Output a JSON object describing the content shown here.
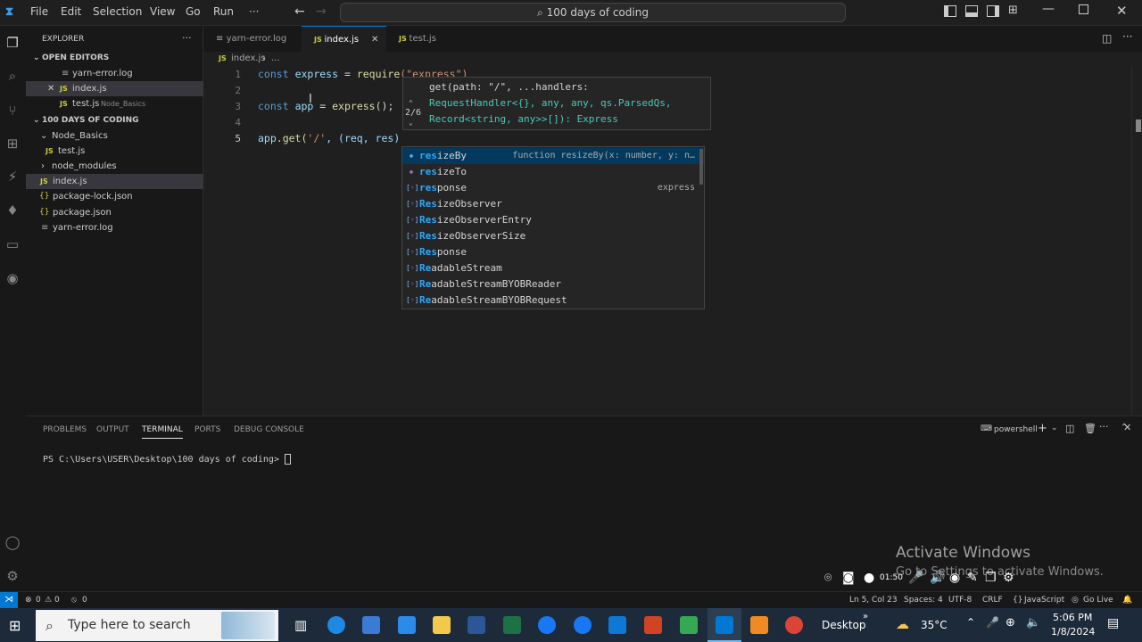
{
  "menu": {
    "file": "File",
    "edit": "Edit",
    "selection": "Selection",
    "view": "View",
    "go": "Go",
    "run": "Run",
    "more": "···"
  },
  "search": {
    "label": "100 days of coding"
  },
  "explorer": {
    "title": "EXPLORER",
    "more": "···",
    "open_editors_header": "OPEN EDITORS",
    "open_editors": [
      {
        "name": "yarn-error.log",
        "hint": ""
      },
      {
        "name": "index.js",
        "hint": ""
      },
      {
        "name": "test.js",
        "hint": "Node_Basics"
      }
    ],
    "folder_header": "100 DAYS OF CODING",
    "tree": [
      {
        "name": "Node_Basics"
      },
      {
        "name": "test.js"
      },
      {
        "name": "node_modules"
      },
      {
        "name": "index.js"
      },
      {
        "name": "package-lock.json"
      },
      {
        "name": "package.json"
      },
      {
        "name": "yarn-error.log"
      }
    ]
  },
  "tabs": [
    {
      "label": "yarn-error.log"
    },
    {
      "label": "index.js"
    },
    {
      "label": "test.js"
    }
  ],
  "breadcrumb": {
    "file": "index.js",
    "rest": "..."
  },
  "editor": {
    "line_numbers": [
      "1",
      "2",
      "3",
      "4",
      "5"
    ],
    "l1": {
      "kw": "const",
      "var": "express",
      "eq": " = ",
      "fn": "require",
      "str": "(\"express\")"
    },
    "l3": {
      "kw": "const",
      "var": "app",
      "eq": " = ",
      "fn": "express",
      "rest": "();"
    },
    "l5": {
      "a": "app",
      "b": ".get(",
      "s": "'/'",
      "c": ", (req, res)"
    }
  },
  "hover": {
    "line1": "get(path: \"/\", ...handlers:",
    "line2": "RequestHandler<{}, any, any, qs.ParsedQs,",
    "line3": "Record<string, any>>[]): Express",
    "counter": "2/6"
  },
  "suggest": [
    {
      "match": "res",
      "rest": "izeBy",
      "detail": "function resizeBy(x: number, y: n…",
      "icon": "method"
    },
    {
      "match": "res",
      "rest": "izeTo",
      "detail": "",
      "icon": "method"
    },
    {
      "match": "res",
      "rest": "ponse",
      "detail": "express",
      "icon": "var"
    },
    {
      "match": "Res",
      "rest": "izeObserver",
      "detail": "",
      "icon": "var"
    },
    {
      "match": "Res",
      "rest": "izeObserverEntry",
      "detail": "",
      "icon": "var"
    },
    {
      "match": "Res",
      "rest": "izeObserverSize",
      "detail": "",
      "icon": "var"
    },
    {
      "match": "Res",
      "rest": "ponse",
      "detail": "",
      "icon": "var"
    },
    {
      "match": "Re",
      "rest": "adableStream",
      "detail": "",
      "icon": "var"
    },
    {
      "match": "Re",
      "rest": "adableStreamBYOBReader",
      "detail": "",
      "icon": "var"
    },
    {
      "match": "Re",
      "rest": "adableStreamBYOBRequest",
      "detail": "",
      "icon": "var"
    }
  ],
  "panel": {
    "tabs": [
      "PROBLEMS",
      "OUTPUT",
      "TERMINAL",
      "PORTS",
      "DEBUG CONSOLE"
    ],
    "shell": "powershell",
    "prompt": "PS C:\\Users\\USER\\Desktop\\100 days of coding> "
  },
  "watermark": {
    "line1": "Activate Windows",
    "line2": "Go to Settings to activate Windows."
  },
  "status": {
    "errors": "0",
    "warnings": "0",
    "ports": "0",
    "position": "Ln 5, Col 23",
    "spaces": "Spaces: 4",
    "encoding": "UTF-8",
    "eol": "CRLF",
    "language": "JavaScript",
    "golive": "Go Live",
    "timer": "01:50"
  },
  "taskbar": {
    "search_placeholder": "Type here to search",
    "desktop": "Desktop",
    "temp": "35°C",
    "time": "5:06 PM",
    "date": "1/8/2024"
  },
  "colors": {
    "accent": "#0078d4",
    "keyword": "#569cd6",
    "variable": "#9cdcfe",
    "function": "#dcdcaa",
    "string": "#ce9178"
  }
}
